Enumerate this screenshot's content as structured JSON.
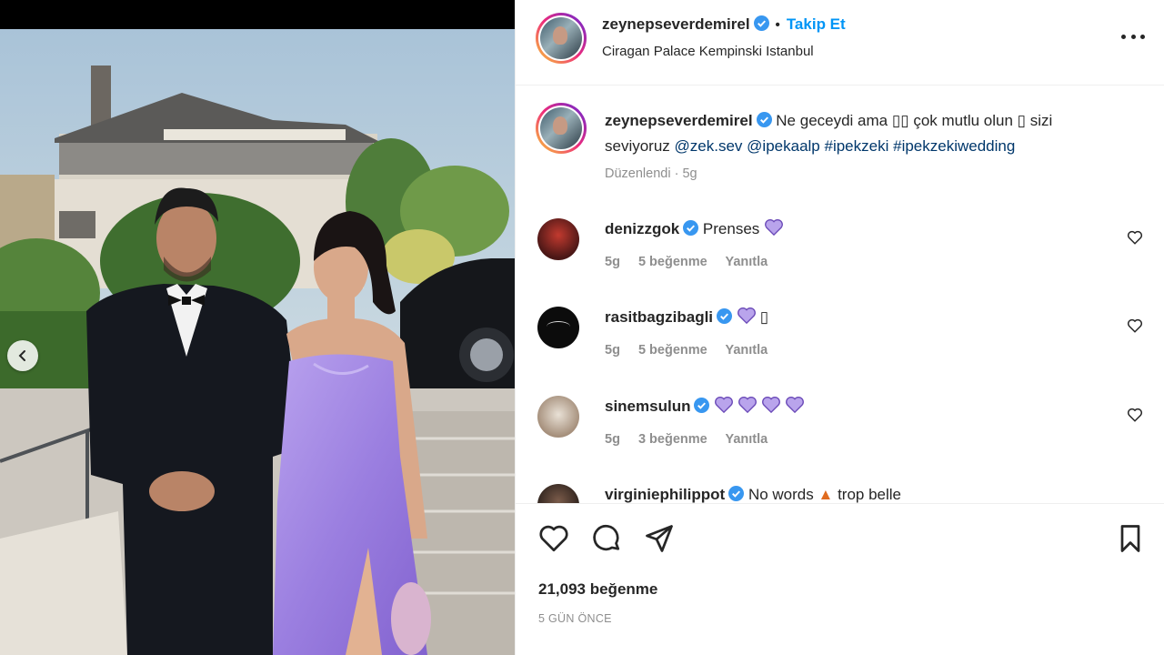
{
  "post": {
    "author": "zeynepseverdemirel",
    "follow_label": "Takip Et",
    "separator": "•",
    "location": "Ciragan Palace Kempinski Istanbul",
    "caption_prefix": "Ne geceydi ama",
    "caption_mid": "çok mutlu olun",
    "caption_mid2": "sizi",
    "caption_line2_start": "seviyoruz",
    "mention_1": "@zek.sev",
    "mention_2": "@ipekaalp",
    "hashtag_1": "#ipekzeki",
    "hashtag_2": "#ipekzekiwedding",
    "caption_meta_edited": "Düzenlendi",
    "caption_meta_sep": "·",
    "caption_meta_time": "5g",
    "likes_label": "21,093 beğenme",
    "date_label": "5 GÜN ÖNCE"
  },
  "comments": [
    {
      "user": "denizzgok",
      "text": "Prenses",
      "hearts": 1,
      "time": "5g",
      "likes": "5 beğenme",
      "reply": "Yanıtla"
    },
    {
      "user": "rasitbagzibagli",
      "text": "",
      "hearts": 1,
      "time": "5g",
      "likes": "5 beğenme",
      "reply": "Yanıtla"
    },
    {
      "user": "sinemsulun",
      "text": "",
      "hearts": 4,
      "time": "5g",
      "likes": "3 beğenme",
      "reply": "Yanıtla"
    },
    {
      "user": "virginiephilippot",
      "text": "No words",
      "text2": "trop belle",
      "hearts": 0
    }
  ],
  "icons": {
    "verified": "verified-badge-icon",
    "like": "heart-outline-icon",
    "comment": "comment-bubble-icon",
    "share": "paper-plane-icon",
    "save": "bookmark-icon",
    "more": "more-horizontal-icon",
    "prev": "chevron-left-icon"
  },
  "colors": {
    "link_blue": "#0095f6",
    "tag_blue": "#00376b",
    "heart_purple": "#8a63d2",
    "verified_blue": "#3897f0"
  }
}
